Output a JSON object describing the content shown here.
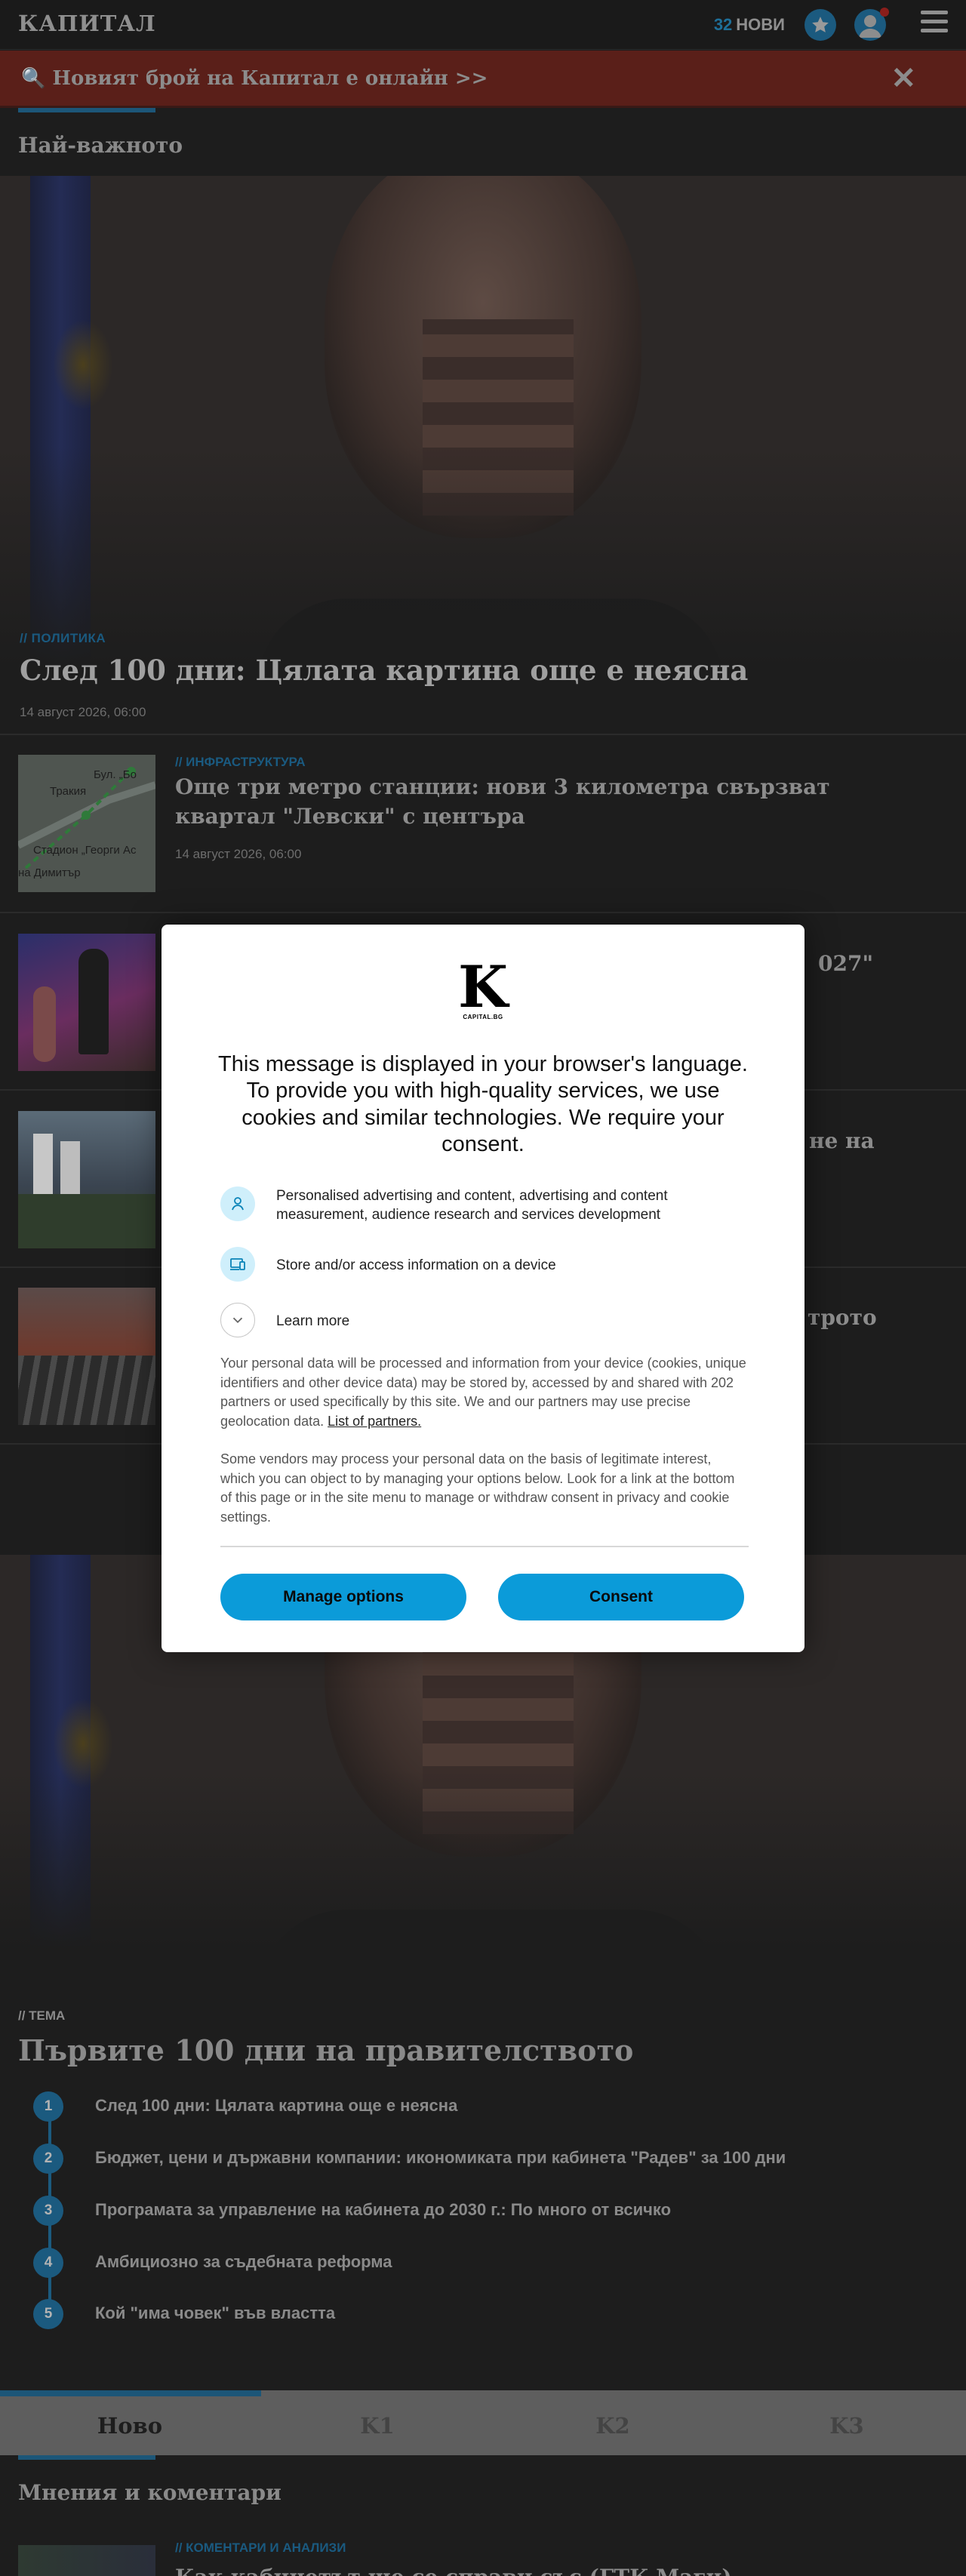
{
  "header": {
    "logo": "КАПИТАЛ",
    "news_count": "32",
    "news_label": "НОВИ",
    "icons": [
      "star-icon",
      "user-icon",
      "menu-icon"
    ]
  },
  "promo": {
    "text": "🔍 Новият брой на Капитал е онлайн >>",
    "close": "✕"
  },
  "top_section": {
    "title": "Най-важното"
  },
  "hero": {
    "tag": "// ПОЛИТИКА",
    "title": "След 100 дни: Цялата картина още е неясна",
    "date": "14 август 2026, 06:00"
  },
  "articles": [
    {
      "tag": "// ИНФРАСТРУКТУРА",
      "title": "Още три метро станции: нови 3 километра свързват квартал \"Левски\" с центъра",
      "date": "14 август 2026, 06:00",
      "thumb_labels": [
        "Бул. „Бо",
        "Тракия",
        "Стадион „Георги Ас",
        "на Димитър"
      ]
    },
    {
      "title_tail": "027\""
    },
    {
      "title_tail": "не на"
    },
    {
      "title_tail": "трото"
    }
  ],
  "topic": {
    "tag": "// ТЕМА",
    "title": "Първите 100 дни на правителството",
    "items": [
      {
        "num": "1",
        "text": "След 100 дни: Цялата картина още е неясна"
      },
      {
        "num": "2",
        "text": "Бюджет, цени и държавни компании: икономиката при кабинета \"Радев\" за 100 дни"
      },
      {
        "num": "3",
        "text": "Програмата за управление на кабинета до 2030 г.: По много от всичко"
      },
      {
        "num": "4",
        "text": "Амбициозно за съдебната реформа"
      },
      {
        "num": "5",
        "text": "Кой \"има човек\" във властта"
      }
    ]
  },
  "tabs": [
    "Ново",
    "K1",
    "K2",
    "K3"
  ],
  "opinion_section": {
    "title": "Мнения и коментари",
    "tag": "// КОМЕНТАРИ И АНАЛИЗИ",
    "title_peek": "Как кабинетът ще се справи със (ГТК Маги) промените"
  },
  "consent": {
    "logo_letter": "K",
    "logo_caption": "CAPITAL.BG",
    "heading": "This message is displayed in your browser's language. To provide you with high-quality services, we use cookies and similar technologies. We require your consent.",
    "purposes": [
      {
        "icon": "person-icon",
        "text": "Personalised advertising and content, advertising and content measurement, audience research and services development"
      },
      {
        "icon": "device-icon",
        "text": "Store and/or access information on a device"
      },
      {
        "icon": "chevron-down-icon",
        "text": "Learn more"
      }
    ],
    "paragraph1": "Your personal data will be processed and information from your device (cookies, unique identifiers and other device data) may be stored by, accessed by and shared with 202 partners or used specifically by this site. We and our partners may use precise geolocation data.",
    "partners_link": "List of partners.",
    "paragraph2": "Some vendors may process your personal data on the basis of legitimate interest, which you can object to by managing your options below. Look for a link at the bottom of this page or in the site menu to manage or withdraw consent in privacy and cookie settings.",
    "manage_label": "Manage options",
    "consent_label": "Consent",
    "accent_color": "#0b9bd9"
  }
}
